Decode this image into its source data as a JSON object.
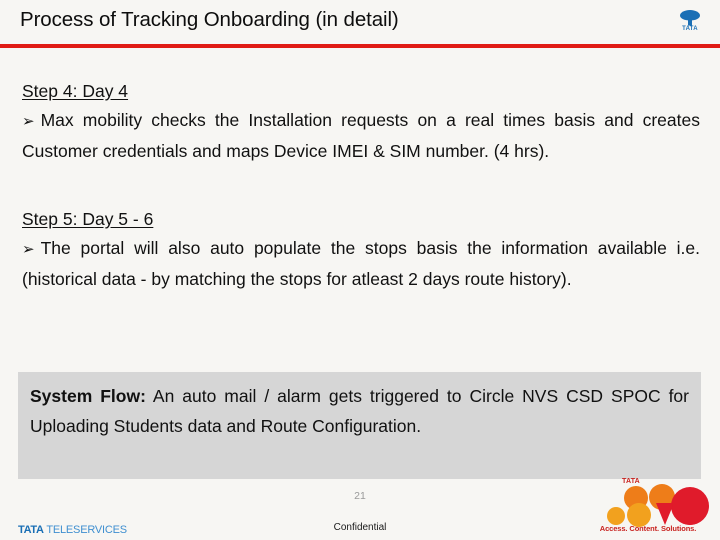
{
  "header": {
    "title": "Process of Tracking Onboarding (in detail)",
    "rule_color": "#e01b14",
    "logo": {
      "name": "tata-logo",
      "wordmark": "TATA",
      "color": "#1a6fb5"
    }
  },
  "content": {
    "bullet_glyph": "➢",
    "steps": [
      {
        "heading": "Step 4: Day 4",
        "body": "Max mobility checks the Installation requests on a real times basis and creates Customer credentials and maps Device IMEI & SIM number. (4 hrs)."
      },
      {
        "heading": "Step 5: Day 5 - 6",
        "body": "The portal will also auto populate the stops basis the information available i.e. (historical data - by matching the stops for atleast 2 days route history)."
      }
    ],
    "system_flow": {
      "label": "System Flow:",
      "text": " An auto mail / alarm gets triggered to Circle NVS CSD SPOC for Uploading Students data and Route Configuration.",
      "background": "#d6d6d6"
    }
  },
  "footer": {
    "brand_primary": "TATA",
    "brand_secondary": " TELESERVICES",
    "page_number": "21",
    "confidential": "Confidential",
    "docomo": {
      "tata_word": "TATA",
      "tagline": "Access. Content. Solutions.",
      "orange": "#ee7d19",
      "red": "#e01b2b",
      "yellow": "#f2a11e"
    }
  }
}
